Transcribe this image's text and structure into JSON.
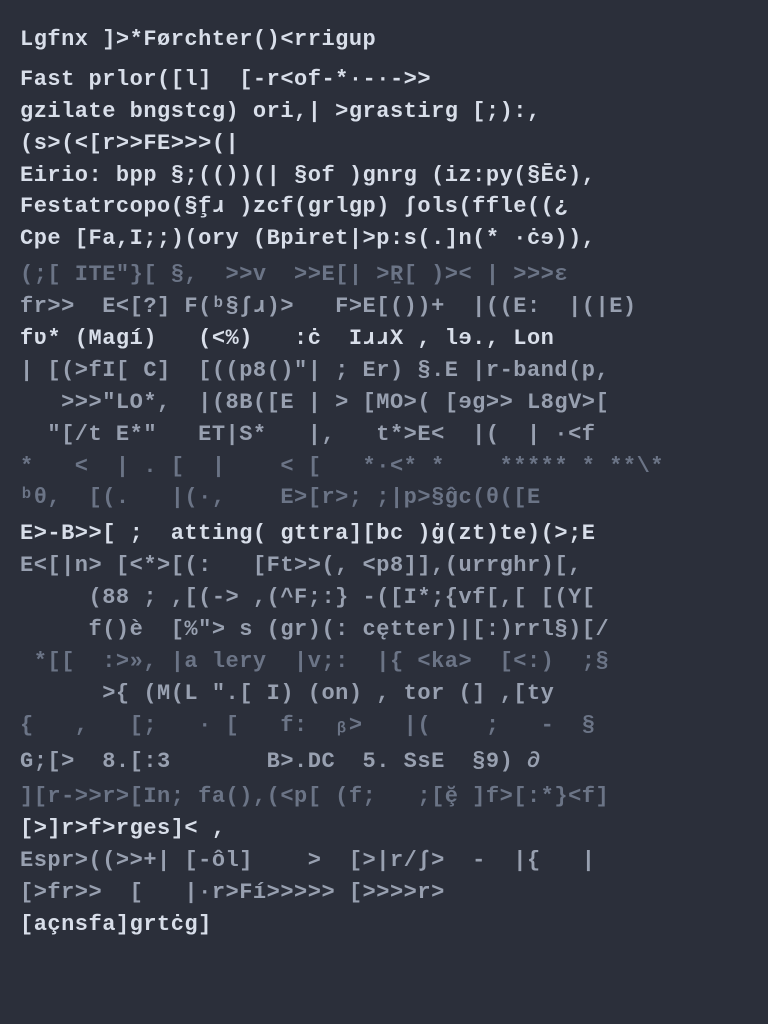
{
  "colors": {
    "bg": "#2b2f3a",
    "bright": "#d8dee9",
    "mid": "#98a0b0",
    "dim": "#6b7486"
  },
  "lines": [
    {
      "cls": "bright",
      "text": "Lgfnx ]>*Førchter()<rrigup"
    },
    {
      "cls": "bright s2",
      "text": "Fast prlor([l]  [-r<of-*·-·->>"
    },
    {
      "cls": "bright",
      "text": "gzilate bngstcg) ori,| >grastirg [;):,"
    },
    {
      "cls": "bright",
      "text": "(s>(<[r>>FE>>>(|"
    },
    {
      "cls": "bright",
      "text": "Eirio: bpp §;(())(| §of )gnrg (iz:py(§Ēċ),"
    },
    {
      "cls": "bright",
      "text": "Festatrcopo(§f̧ɹ )zcf(grlgp) ∫ols(ffle((¿"
    },
    {
      "cls": "bright",
      "text": "Cpe [Fa,I;;)(ory (Bpiret|>p:s(.]n(* ·ċɘ)),"
    },
    {
      "cls": "dim s1",
      "text": "(;[ ITE\"}[ §,  >>v  >>E[| >Ṟ[ )>< | >>>ε"
    },
    {
      "cls": "mid",
      "text": "fr>>  E<[?] F(ᵇ§∫ɹ)>   F>E[())+  |((E:  |(|E)"
    },
    {
      "cls": "bright",
      "text": "fʋ* (Magí)   (<%)   :ċ  IɹɹX , lɘ., Lon"
    },
    {
      "cls": "mid",
      "text": "| [(>fI[ C]  [((p8()\"| ; Er) §.E |r-band(p,"
    },
    {
      "cls": "mid",
      "text": "   >>>\"LO*,  |(8B([E | > [MO>( [ɘg>> L8gV>["
    },
    {
      "cls": "mid",
      "text": "  \"[/t E*\"   ET|S*   |,   t*>E<  |(  | ·<f"
    },
    {
      "cls": "dim",
      "text": "*   <  | . [  |    < [   *·<* *    ***** * **\\*"
    },
    {
      "cls": "dim",
      "text": "ᵇθ,  [(.   |(·,    E>[r>; ;|p>§ĝc(θ([E"
    },
    {
      "cls": "bright s1",
      "text": "E>-B>>[ ;  atting( gttra][bc )ġ(zt)te)(>;E"
    },
    {
      "cls": "mid",
      "text": "E<[|n> [<*>[(:   [Ft>>(, <p8]],(urrghr)[,"
    },
    {
      "cls": "mid",
      "text": "     (88 ; ,[(-> ,(^F;:} -([I*;{vf[,[ [(Y["
    },
    {
      "cls": "mid",
      "text": "     f()è  [%\"> s (gr)(: cętter)|[:)rrl§)[/"
    },
    {
      "cls": "dim",
      "text": " *[[  :>», |a lery  |v;:  |{ <ka>  [<:)  ;§"
    },
    {
      "cls": "mid",
      "text": "      >{ (M(L \".[ I) (on) , tor (] ,[ty"
    },
    {
      "cls": "dim",
      "text": "{   ,   [;   · [   f:  ᵦ>   |(    ;   -  §"
    },
    {
      "cls": "mid s1",
      "text": "G;[>  8.[:3       B>.DC  5. SsE  §9) ∂"
    },
    {
      "cls": "dim s1",
      "text": "][r->>r>[In; fa(),(<p[ (f;   ;[ḝ ]f>[:*}<f]"
    },
    {
      "cls": "bright",
      "text": "[>]r>f>rges]< ,"
    },
    {
      "cls": "mid",
      "text": "Espr>((>>+| [-ôl]    >  [>|r/∫>  -  |{   |"
    },
    {
      "cls": "mid",
      "text": "[>fr>>  [   |·r>Fí>>>>> [>>>>r>"
    },
    {
      "cls": "bright",
      "text": "[açnsfa]grtċg]"
    }
  ]
}
